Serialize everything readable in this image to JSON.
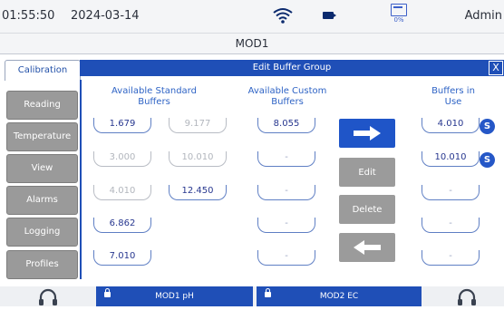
{
  "status": {
    "time": "01:55:50",
    "date": "2024-03-14",
    "disk_pct": "0%",
    "user": "Admin"
  },
  "module_title": "MOD1",
  "active_tab": "Calibration",
  "nav": [
    "Reading",
    "Temperature",
    "View",
    "Alarms",
    "Logging",
    "Profiles"
  ],
  "dialog": {
    "title": "Edit Buffer Group",
    "close": "X"
  },
  "columns": {
    "standard": "Available Standard Buffers",
    "custom": "Available Custom Buffers",
    "in_use": "Buffers in Use"
  },
  "standard_col1": [
    "1.679",
    "3.000",
    "4.010",
    "6.862",
    "7.010"
  ],
  "standard_col2": [
    "9.177",
    "10.010",
    "12.450"
  ],
  "custom": [
    "8.055",
    "-",
    "-",
    "-",
    "-"
  ],
  "in_use": [
    "4.010",
    "10.010",
    "-",
    "-",
    "-"
  ],
  "in_use_badge": "S",
  "actions": {
    "edit": "Edit",
    "delete": "Delete"
  },
  "bottom": {
    "mod1": "MOD1 pH",
    "mod2": "MOD2 EC"
  },
  "colors": {
    "accent": "#1f4fb7",
    "button_grey": "#9b9b9b"
  }
}
